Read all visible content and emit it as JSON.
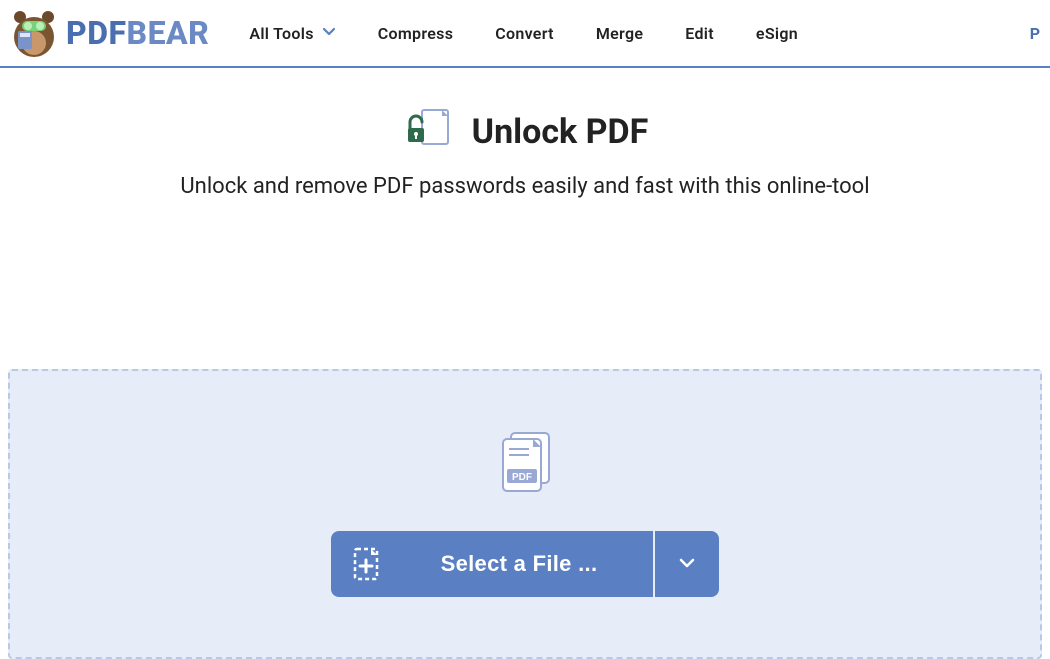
{
  "brand": {
    "part1": "PDF",
    "part2": "BEAR"
  },
  "nav": {
    "all_tools": "All Tools",
    "compress": "Compress",
    "convert": "Convert",
    "merge": "Merge",
    "edit": "Edit",
    "esign": "eSign"
  },
  "right_link": "P",
  "hero": {
    "title": "Unlock PDF",
    "subtitle": "Unlock and remove PDF passwords easily and fast with this online-tool"
  },
  "upload": {
    "button_label": "Select a File ...",
    "file_badge": "PDF"
  }
}
